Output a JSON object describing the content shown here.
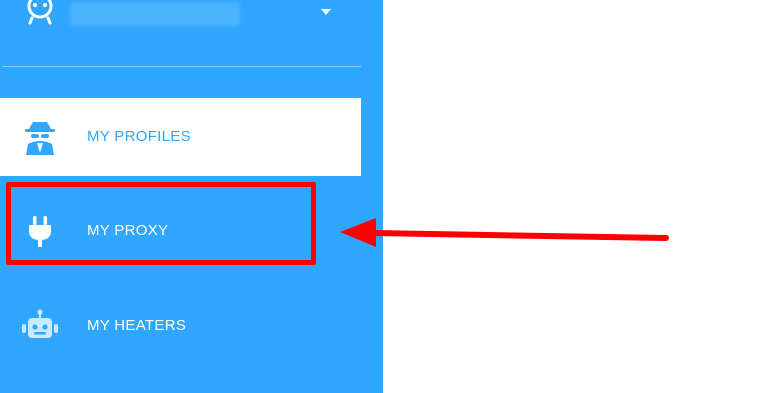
{
  "colors": {
    "sidebar_bg": "#2fa6ff",
    "active_bg": "#ffffff",
    "accent": "#2fa6ff",
    "annotation": "#ff0000"
  },
  "user": {
    "name": "",
    "avatar_icon": "robot-face-icon",
    "dropdown_icon": "caret-down-icon"
  },
  "nav": {
    "items": [
      {
        "label": "MY PROFILES",
        "icon": "spy-agent-icon",
        "active": true
      },
      {
        "label": "MY PROXY",
        "icon": "plug-icon",
        "active": false
      },
      {
        "label": "MY HEATERS",
        "icon": "robot-icon",
        "active": false
      }
    ]
  },
  "annotation": {
    "target": "MY PROXY",
    "shape": "red rectangle with red arrow pointing left"
  }
}
